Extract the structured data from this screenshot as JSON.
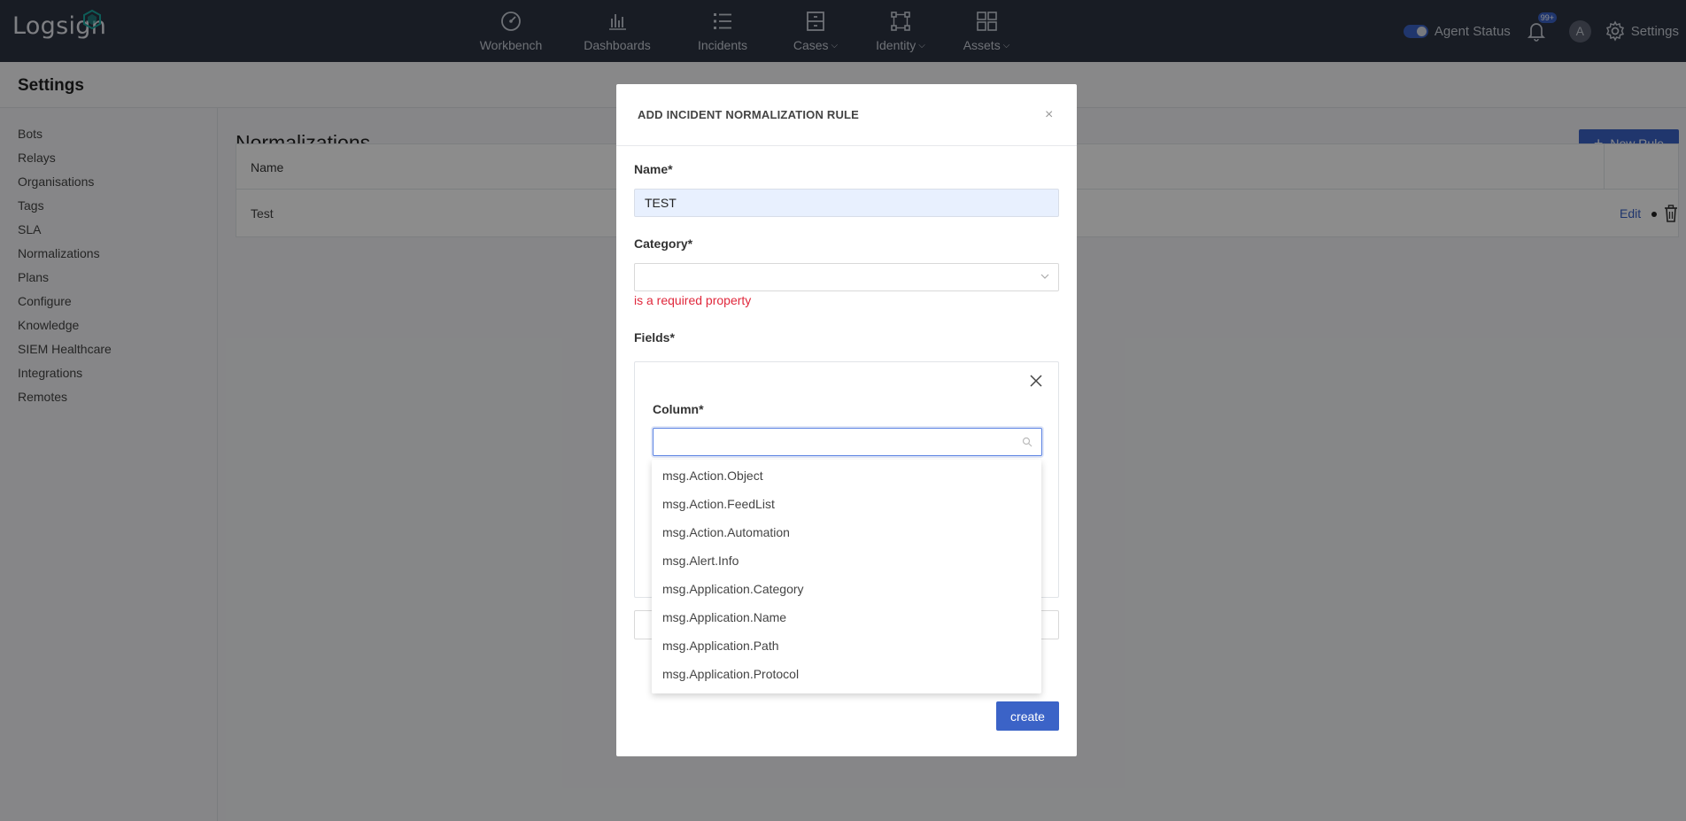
{
  "app": {
    "logo_text": "Logsign"
  },
  "nav": {
    "items": [
      {
        "label": "Workbench",
        "icon": "speedometer-icon",
        "has_dropdown": false
      },
      {
        "label": "Dashboards",
        "icon": "bar-chart-icon",
        "has_dropdown": false
      },
      {
        "label": "Incidents",
        "icon": "list-icon",
        "has_dropdown": false
      },
      {
        "label": "Cases",
        "icon": "cabinet-icon",
        "has_dropdown": true
      },
      {
        "label": "Identity",
        "icon": "nodes-icon",
        "has_dropdown": true
      },
      {
        "label": "Assets",
        "icon": "grid-icon",
        "has_dropdown": true
      }
    ],
    "agent_status_label": "Agent Status",
    "notification_badge": "99+",
    "avatar_initial": "A",
    "settings_label": "Settings"
  },
  "page": {
    "title": "Settings"
  },
  "sidebar": {
    "items": [
      {
        "label": "Bots"
      },
      {
        "label": "Relays"
      },
      {
        "label": "Organisations"
      },
      {
        "label": "Tags"
      },
      {
        "label": "SLA"
      },
      {
        "label": "Normalizations"
      },
      {
        "label": "Plans"
      },
      {
        "label": "Configure"
      },
      {
        "label": "Knowledge"
      },
      {
        "label": "SIEM Healthcare"
      },
      {
        "label": "Integrations"
      },
      {
        "label": "Remotes"
      }
    ]
  },
  "main": {
    "title": "Normalizations",
    "new_rule_label": "New Rule",
    "table": {
      "header": "Name",
      "rows": [
        {
          "name": "Test",
          "edit_label": "Edit"
        }
      ]
    }
  },
  "modal": {
    "title": "ADD INCIDENT NORMALIZATION RULE",
    "close_glyph": "×",
    "name_label": "Name*",
    "name_value": "TEST",
    "category_label": "Category*",
    "category_error": "is a required property",
    "fields_label": "Fields*",
    "column_label": "Column*",
    "create_label": "create"
  },
  "dropdown": {
    "options": [
      "msg.Action.Object",
      "msg.Action.FeedList",
      "msg.Action.Automation",
      "msg.Alert.Info",
      "msg.Application.Category",
      "msg.Application.Name",
      "msg.Application.Path",
      "msg.Application.Protocol"
    ]
  },
  "colors": {
    "topbar": "#2c3342",
    "accent": "#3b63c7",
    "error": "#e0283c"
  }
}
